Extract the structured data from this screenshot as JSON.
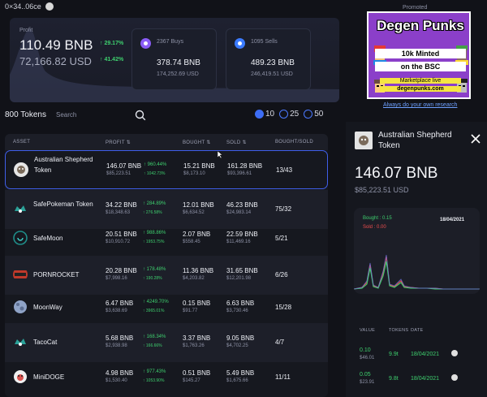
{
  "topbar": {
    "address": "0×34..06ce"
  },
  "summary": {
    "profit_label": "Profit",
    "bnb": "110.49 BNB",
    "usd": "72,166.82 USD",
    "change_bnb": "↑ 29.17%",
    "change_usd": "↑ 41.42%",
    "buys": {
      "label": "2367 Buys",
      "bnb": "378.74 BNB",
      "usd": "174,252.69 USD",
      "color": "#8a5cf6"
    },
    "sells": {
      "label": "1095 Sells",
      "bnb": "489.23 BNB",
      "usd": "246,419.51 USD",
      "color": "#3b7bff"
    }
  },
  "promo": {
    "label": "Promoted",
    "title": "Degen Punks",
    "line1": "10k Minted",
    "line2": "on the BSC",
    "line3": "Marketplace live",
    "line4": "degenpunks.com",
    "research": "Always do your own research"
  },
  "tokens": {
    "count": "800 Tokens",
    "search_placeholder": "Search",
    "page_sizes": [
      "10",
      "25",
      "50"
    ],
    "selected_size": "10"
  },
  "table": {
    "headers": {
      "asset": "ASSET",
      "profit": "PROFIT ⇅",
      "bought": "BOUGHT ⇅",
      "sold": "SOLD ⇅",
      "ratio": "BOUGHT/SOLD"
    },
    "rows": [
      {
        "name": "Australian Shepherd Token",
        "profit_bnb": "146.07 BNB",
        "profit_usd": "$85,223.51",
        "pct1": "↑ 960.44%",
        "pct2": "↑ 1042.73%",
        "bought_bnb": "15.21 BNB",
        "bought_usd": "$8,173.10",
        "sold_bnb": "161.28 BNB",
        "sold_usd": "$93,396.61",
        "ratio": "13/43",
        "logo_color": "#cfcfcf"
      },
      {
        "name": "SafePokeman Token",
        "profit_bnb": "34.22 BNB",
        "profit_usd": "$18,348.63",
        "pct1": "↑ 284.89%",
        "pct2": "↑ 276.58%",
        "bought_bnb": "12.01 BNB",
        "bought_usd": "$6,634.52",
        "sold_bnb": "46.23 BNB",
        "sold_usd": "$24,983.14",
        "ratio": "75/32",
        "logo_color": "#2aa198"
      },
      {
        "name": "SafeMoon",
        "profit_bnb": "20.51 BNB",
        "profit_usd": "$10,910.72",
        "pct1": "↑ 988.86%",
        "pct2": "↑ 1953.75%",
        "bought_bnb": "2.07 BNB",
        "bought_usd": "$558.45",
        "sold_bnb": "22.59 BNB",
        "sold_usd": "$11,469.16",
        "ratio": "5/21",
        "logo_color": "#1f8f8a"
      },
      {
        "name": "PORNROCKET",
        "profit_bnb": "20.28 BNB",
        "profit_usd": "$7,998.16",
        "pct1": "↑ 178.48%",
        "pct2": "↑ 190.28%",
        "bought_bnb": "11.36 BNB",
        "bought_usd": "$4,203.82",
        "sold_bnb": "31.65 BNB",
        "sold_usd": "$12,201.98",
        "ratio": "6/26",
        "logo_color": "#c0392b"
      },
      {
        "name": "MoonWay",
        "profit_bnb": "6.47 BNB",
        "profit_usd": "$3,638.69",
        "pct1": "↑ 4249.70%",
        "pct2": "↑ 3965.01%",
        "bought_bnb": "0.15 BNB",
        "bought_usd": "$91.77",
        "sold_bnb": "6.63 BNB",
        "sold_usd": "$3,730.46",
        "ratio": "15/28",
        "logo_color": "#8fa3c7"
      },
      {
        "name": "TacoCat",
        "profit_bnb": "5.68 BNB",
        "profit_usd": "$2,938.98",
        "pct1": "↑ 168.34%",
        "pct2": "↑ 166.66%",
        "bought_bnb": "3.37 BNB",
        "bought_usd": "$1,763.26",
        "sold_bnb": "9.05 BNB",
        "sold_usd": "$4,702.25",
        "ratio": "4/7",
        "logo_color": "#2aa198"
      },
      {
        "name": "MiniDOGE",
        "profit_bnb": "4.98 BNB",
        "profit_usd": "$1,530.40",
        "pct1": "↑ 977.43%",
        "pct2": "↑ 1053.90%",
        "bought_bnb": "0.51 BNB",
        "bought_usd": "$145.27",
        "sold_bnb": "5.49 BNB",
        "sold_usd": "$1,675.66",
        "ratio": "11/11",
        "logo_color": "#e8e8e8"
      }
    ]
  },
  "detail": {
    "name": "Australian Shepherd Token",
    "bnb": "146.07 BNB",
    "usd": "$85,223.51 USD",
    "bought_label": "Bought : 0.15",
    "sold_label": "Sold : 0.00",
    "date": "18/04/2021",
    "headers": {
      "value": "VALUE",
      "tokens": "TOKENS",
      "date": "DATE"
    },
    "txs": [
      {
        "value": "0.10",
        "usd": "$46.01",
        "tokens": "9.9t",
        "date": "18/04/2021"
      },
      {
        "value": "0.05",
        "usd": "$23.91",
        "tokens": "9.8t",
        "date": "18/04/2021"
      }
    ]
  }
}
